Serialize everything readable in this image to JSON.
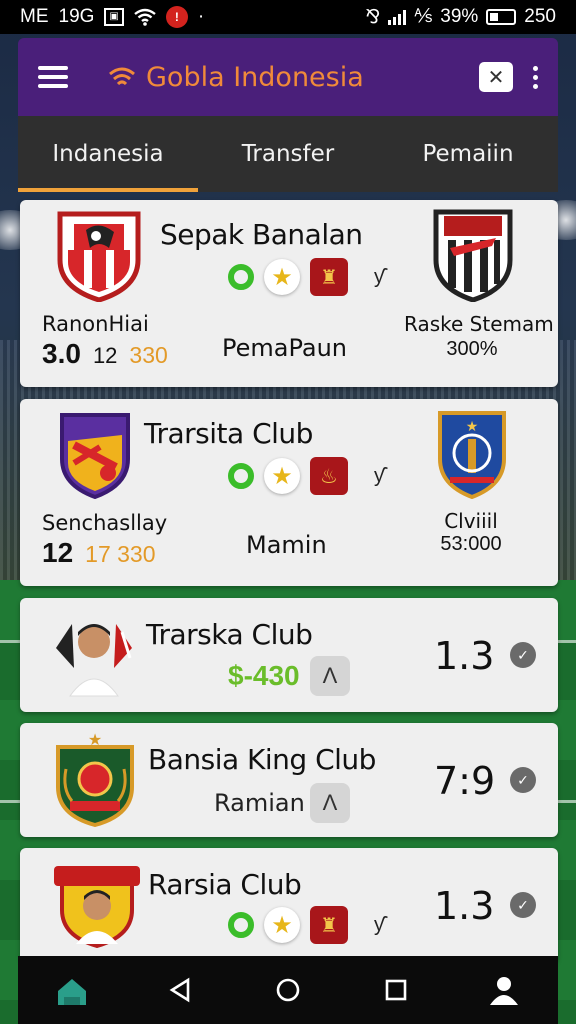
{
  "status_bar": {
    "carrier": "ME",
    "time": "19G",
    "notification_badge": "!",
    "extra_icons": "·",
    "battery_pct": "39%",
    "signal_text": "250"
  },
  "header": {
    "title": "Gobla Indonesia",
    "close_label": "✕"
  },
  "tabs": [
    {
      "label": "Indanesia",
      "active": true
    },
    {
      "label": "Transfer",
      "active": false
    },
    {
      "label": "Pemaiin",
      "active": false
    }
  ],
  "cards": [
    {
      "title": "Sepak Banalan",
      "left_name": "RanonHiai",
      "left_num_big": "3.0",
      "left_num_mid": "12",
      "left_num_orange": "330",
      "center_label": "PemaPaun",
      "right_name": "Raske Stemam",
      "right_value": "300%"
    },
    {
      "title": "Trarsita Club",
      "left_name": "Senchasllay",
      "left_num_big": "12",
      "left_num_orange": "17 330",
      "center_label": "Mamin",
      "right_name": "Clviiil",
      "right_value": "53:000"
    },
    {
      "title": "Trarska Club",
      "price": "$-430",
      "score": "1.3"
    },
    {
      "title": "Bansia King Club",
      "sub_label": "Ramian",
      "score": "7:9"
    },
    {
      "title": "Rarsia Club",
      "score": "1.3"
    }
  ],
  "icons": {
    "menu": "hamburger-icon",
    "more": "more-vert-icon",
    "star": "★",
    "antenna": "ƴ",
    "chevron": "✔",
    "person": "὆4"
  },
  "colors": {
    "header_bg": "#4a1f7a",
    "brand_orange": "#f08a3a",
    "tab_accent": "#f0a23a",
    "price_green": "#6abd2a",
    "value_orange": "#e39a28"
  }
}
